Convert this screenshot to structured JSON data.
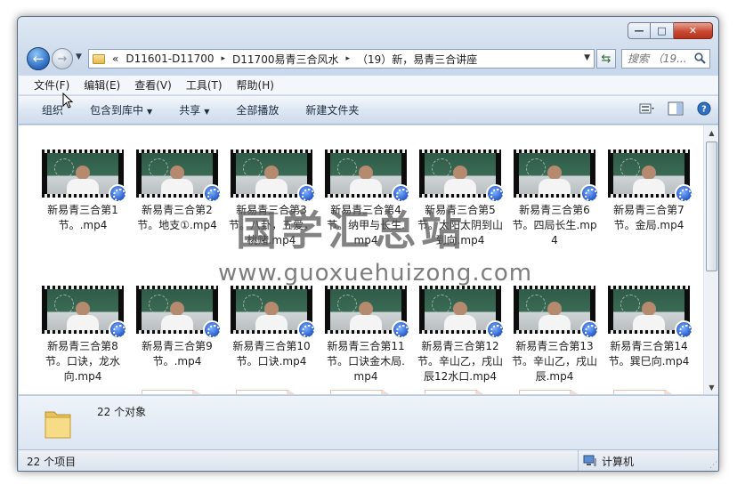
{
  "window": {
    "caption": {
      "minimize": "—",
      "maximize": "□",
      "close": "✕"
    }
  },
  "address": {
    "overflow": "«",
    "crumbs": [
      "D11601-D11700",
      "D11700易青三合风水",
      "（19）新，易青三合讲座"
    ],
    "separator": "▸"
  },
  "search": {
    "placeholder": "搜索 （19..."
  },
  "menu": [
    "文件(F)",
    "编辑(E)",
    "查看(V)",
    "工具(T)",
    "帮助(H)"
  ],
  "toolbar": {
    "organize": "组织",
    "include_in_library": "包含到库中",
    "share": "共享",
    "play_all": "全部播放",
    "new_folder": "新建文件夹",
    "dropdown_arrow": "▼"
  },
  "files": [
    {
      "name": "新易青三合第1节。.mp4"
    },
    {
      "name": "新易青三合第2节。地支①.mp4"
    },
    {
      "name": "新易青三合第3节。八卦，五爱，桃赌.mp4"
    },
    {
      "name": "新易青三合第4节。纳甲与长生.mp4"
    },
    {
      "name": "新易青三合第5节。太阳太阴到山到向.mp4"
    },
    {
      "name": "新易青三合第6节。四局长生.mp4"
    },
    {
      "name": "新易青三合第7节。金局.mp4"
    },
    {
      "name": "新易青三合第8节。口诀，龙水向.mp4"
    },
    {
      "name": "新易青三合第9节。.mp4"
    },
    {
      "name": "新易青三合第10节。口诀.mp4"
    },
    {
      "name": "新易青三合第11节。口诀金木局.mp4"
    },
    {
      "name": "新易青三合第12节。辛山乙，戌山辰12水口.mp4"
    },
    {
      "name": "新易青三合第13节。辛山乙，戌山辰.mp4"
    },
    {
      "name": "新易青三合第14节。巽巳向.mp4"
    }
  ],
  "watermark": {
    "title": "国学汇总站",
    "url": "www.guoxuehuizong.com"
  },
  "details": {
    "count": "22 个对象"
  },
  "status": {
    "items": "22 个项目",
    "location": "计算机"
  },
  "colors": {
    "accent": "#2f6fc4",
    "close_red": "#c94a33",
    "chrome": "#c9d8ea"
  }
}
